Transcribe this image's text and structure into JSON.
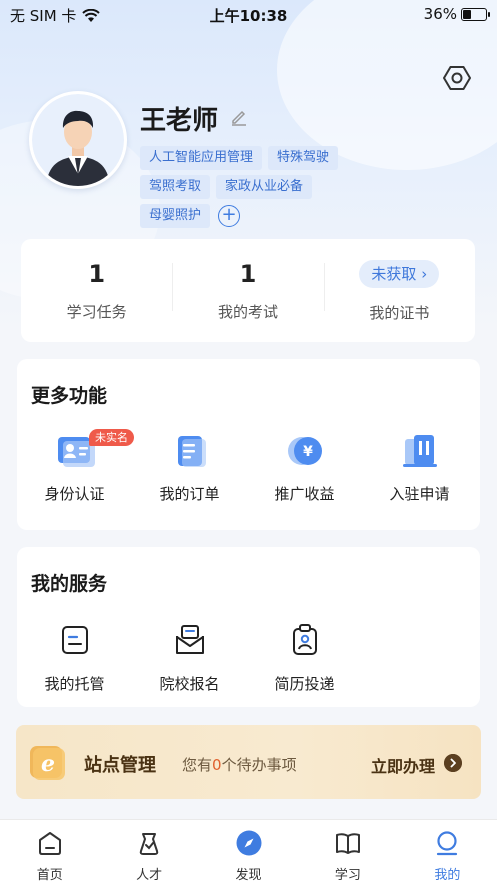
{
  "status_bar": {
    "carrier": "无 SIM 卡",
    "time": "上午10:38",
    "battery": "36%",
    "battery_level": 0.36
  },
  "profile": {
    "name": "王老师",
    "tags": [
      "人工智能应用管理",
      "特殊驾驶",
      "驾照考取",
      "家政从业必备",
      "母婴照护"
    ]
  },
  "stats": [
    {
      "value": "1",
      "label": "学习任务"
    },
    {
      "value": "1",
      "label": "我的考试"
    },
    {
      "value": "未获取 ›",
      "label": "我的证书"
    }
  ],
  "more_functions": {
    "title": "更多功能",
    "items": [
      {
        "label": "身份认证",
        "badge": "未实名",
        "icon": "id-card-icon"
      },
      {
        "label": "我的订单",
        "icon": "order-icon"
      },
      {
        "label": "推广收益",
        "icon": "yen-coin-icon"
      },
      {
        "label": "入驻申请",
        "icon": "building-icon"
      }
    ]
  },
  "my_services": {
    "title": "我的服务",
    "items": [
      {
        "label": "我的托管",
        "icon": "trust-icon"
      },
      {
        "label": "院校报名",
        "icon": "envelope-icon"
      },
      {
        "label": "简历投递",
        "icon": "resume-icon"
      }
    ]
  },
  "station": {
    "title": "站点管理",
    "todo_prefix": "您有",
    "todo_count": "0",
    "todo_suffix": "个待办事项",
    "action": "立即办理"
  },
  "tabbar": [
    {
      "label": "首页",
      "icon": "home-icon"
    },
    {
      "label": "人才",
      "icon": "talent-icon"
    },
    {
      "label": "发现",
      "icon": "compass-icon"
    },
    {
      "label": "学习",
      "icon": "book-icon"
    },
    {
      "label": "我的",
      "icon": "profile-icon",
      "active": true
    }
  ],
  "colors": {
    "accent": "#3f7ce0",
    "badge": "#ef5a4a",
    "station_bg": "#f6e6c8"
  }
}
